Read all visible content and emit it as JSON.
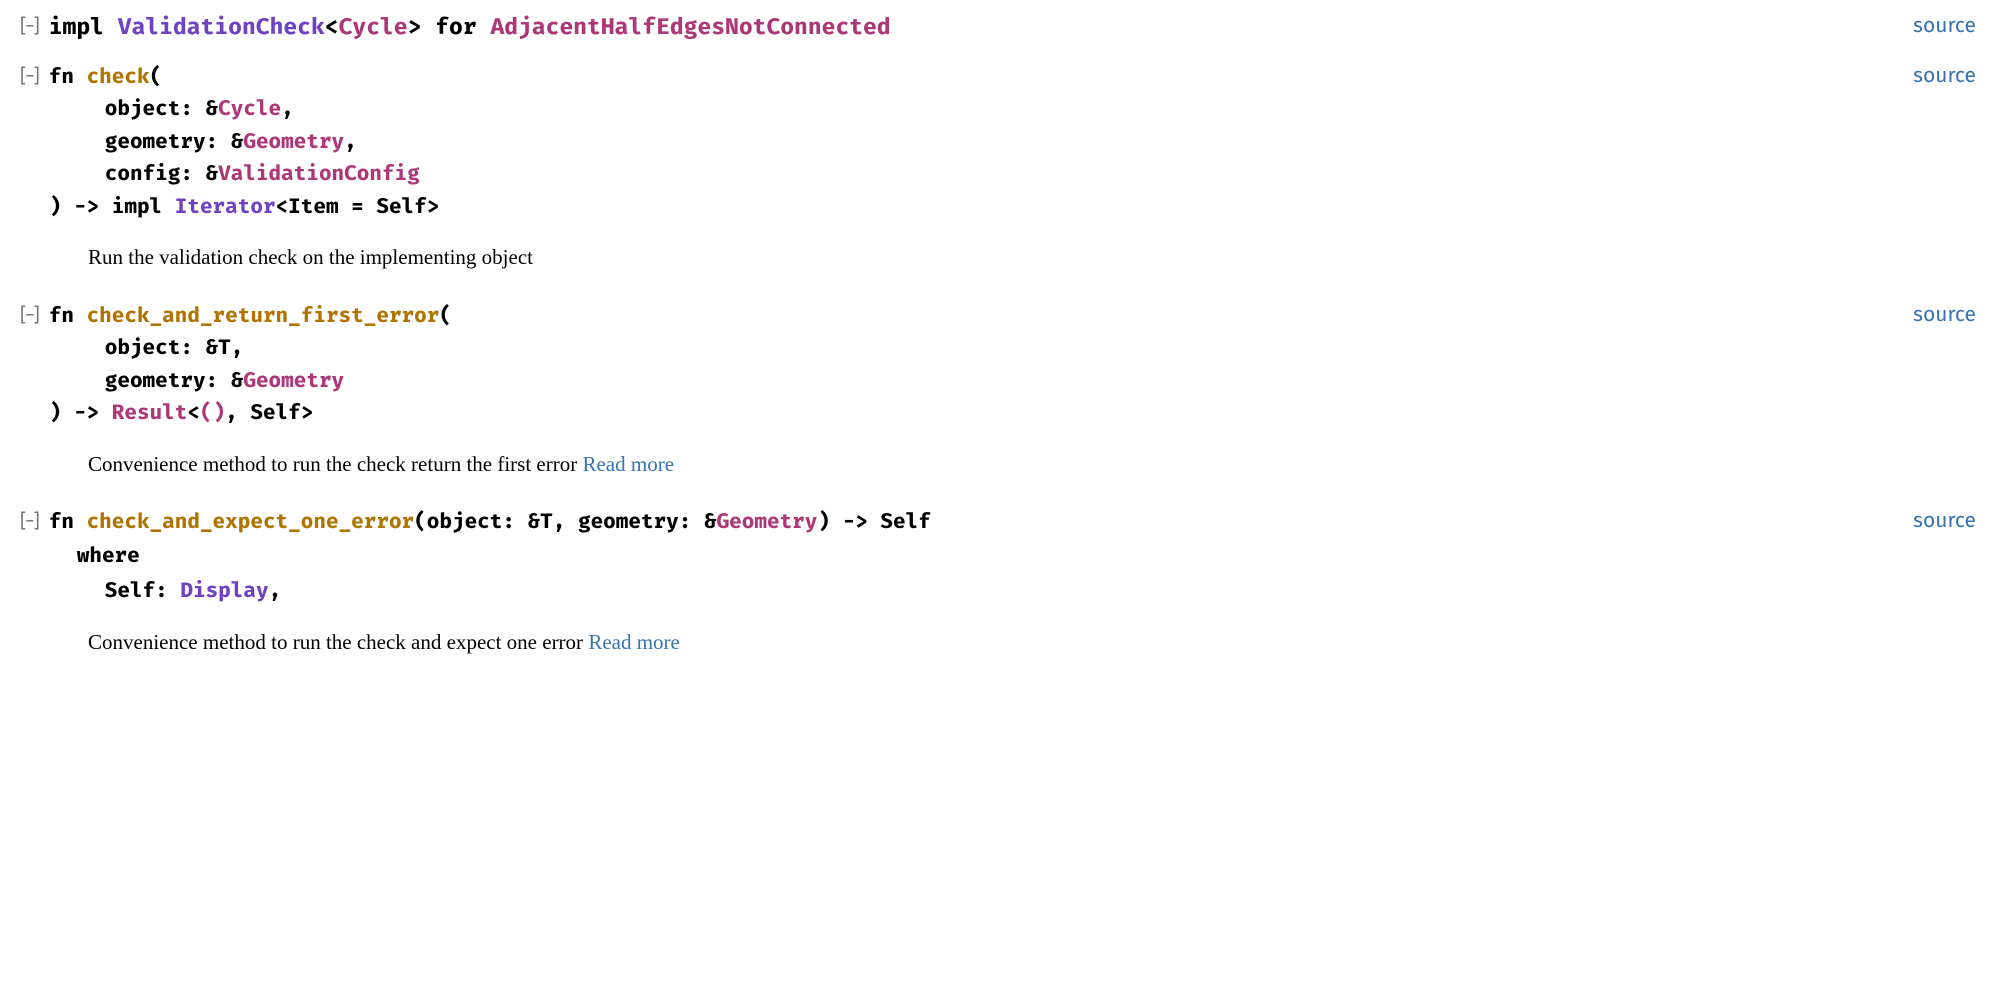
{
  "source_label": "source",
  "impl": {
    "keyword_impl": "impl ",
    "trait": "ValidationCheck",
    "lt": "<",
    "cycle": "Cycle",
    "gt": ">",
    "keyword_for": " for ",
    "struct": "AdjacentHalfEdgesNotConnected"
  },
  "toggle": "[−]",
  "methods": {
    "check": {
      "fn_kw": "fn ",
      "name": "check",
      "open": "(",
      "p1_name": "object: &",
      "p1_type": "Cycle",
      "p1_comma": ",",
      "p2_name": "geometry: &",
      "p2_type": "Geometry",
      "p2_comma": ",",
      "p3_name": "config: &",
      "p3_type": "ValidationConfig",
      "ret_arrow": ") -> impl ",
      "ret_trait": "Iterator",
      "ret_rest": "<Item = Self>",
      "doc": "Run the validation check on the implementing object"
    },
    "check_first": {
      "fn_kw": "fn ",
      "name": "check_and_return_first_error",
      "open": "(",
      "p1_name": "object: &T,",
      "p2_name": "geometry: &",
      "p2_type": "Geometry",
      "ret_arrow": ") -> ",
      "ret_type": "Result",
      "ret_open": "<",
      "ret_unit": "()",
      "ret_rest": ", Self>",
      "doc": "Convenience method to run the check return the first error ",
      "read_more": "Read more"
    },
    "check_expect": {
      "fn_kw": "fn ",
      "name": "check_and_expect_one_error",
      "open": "(object: &T, geometry: &",
      "geom_type": "Geometry",
      "close": ") -> Self",
      "where_kw": "where",
      "where_self": "Self: ",
      "where_trait": "Display",
      "where_comma": ",",
      "doc": "Convenience method to run the check and expect one error ",
      "read_more": "Read more"
    }
  }
}
